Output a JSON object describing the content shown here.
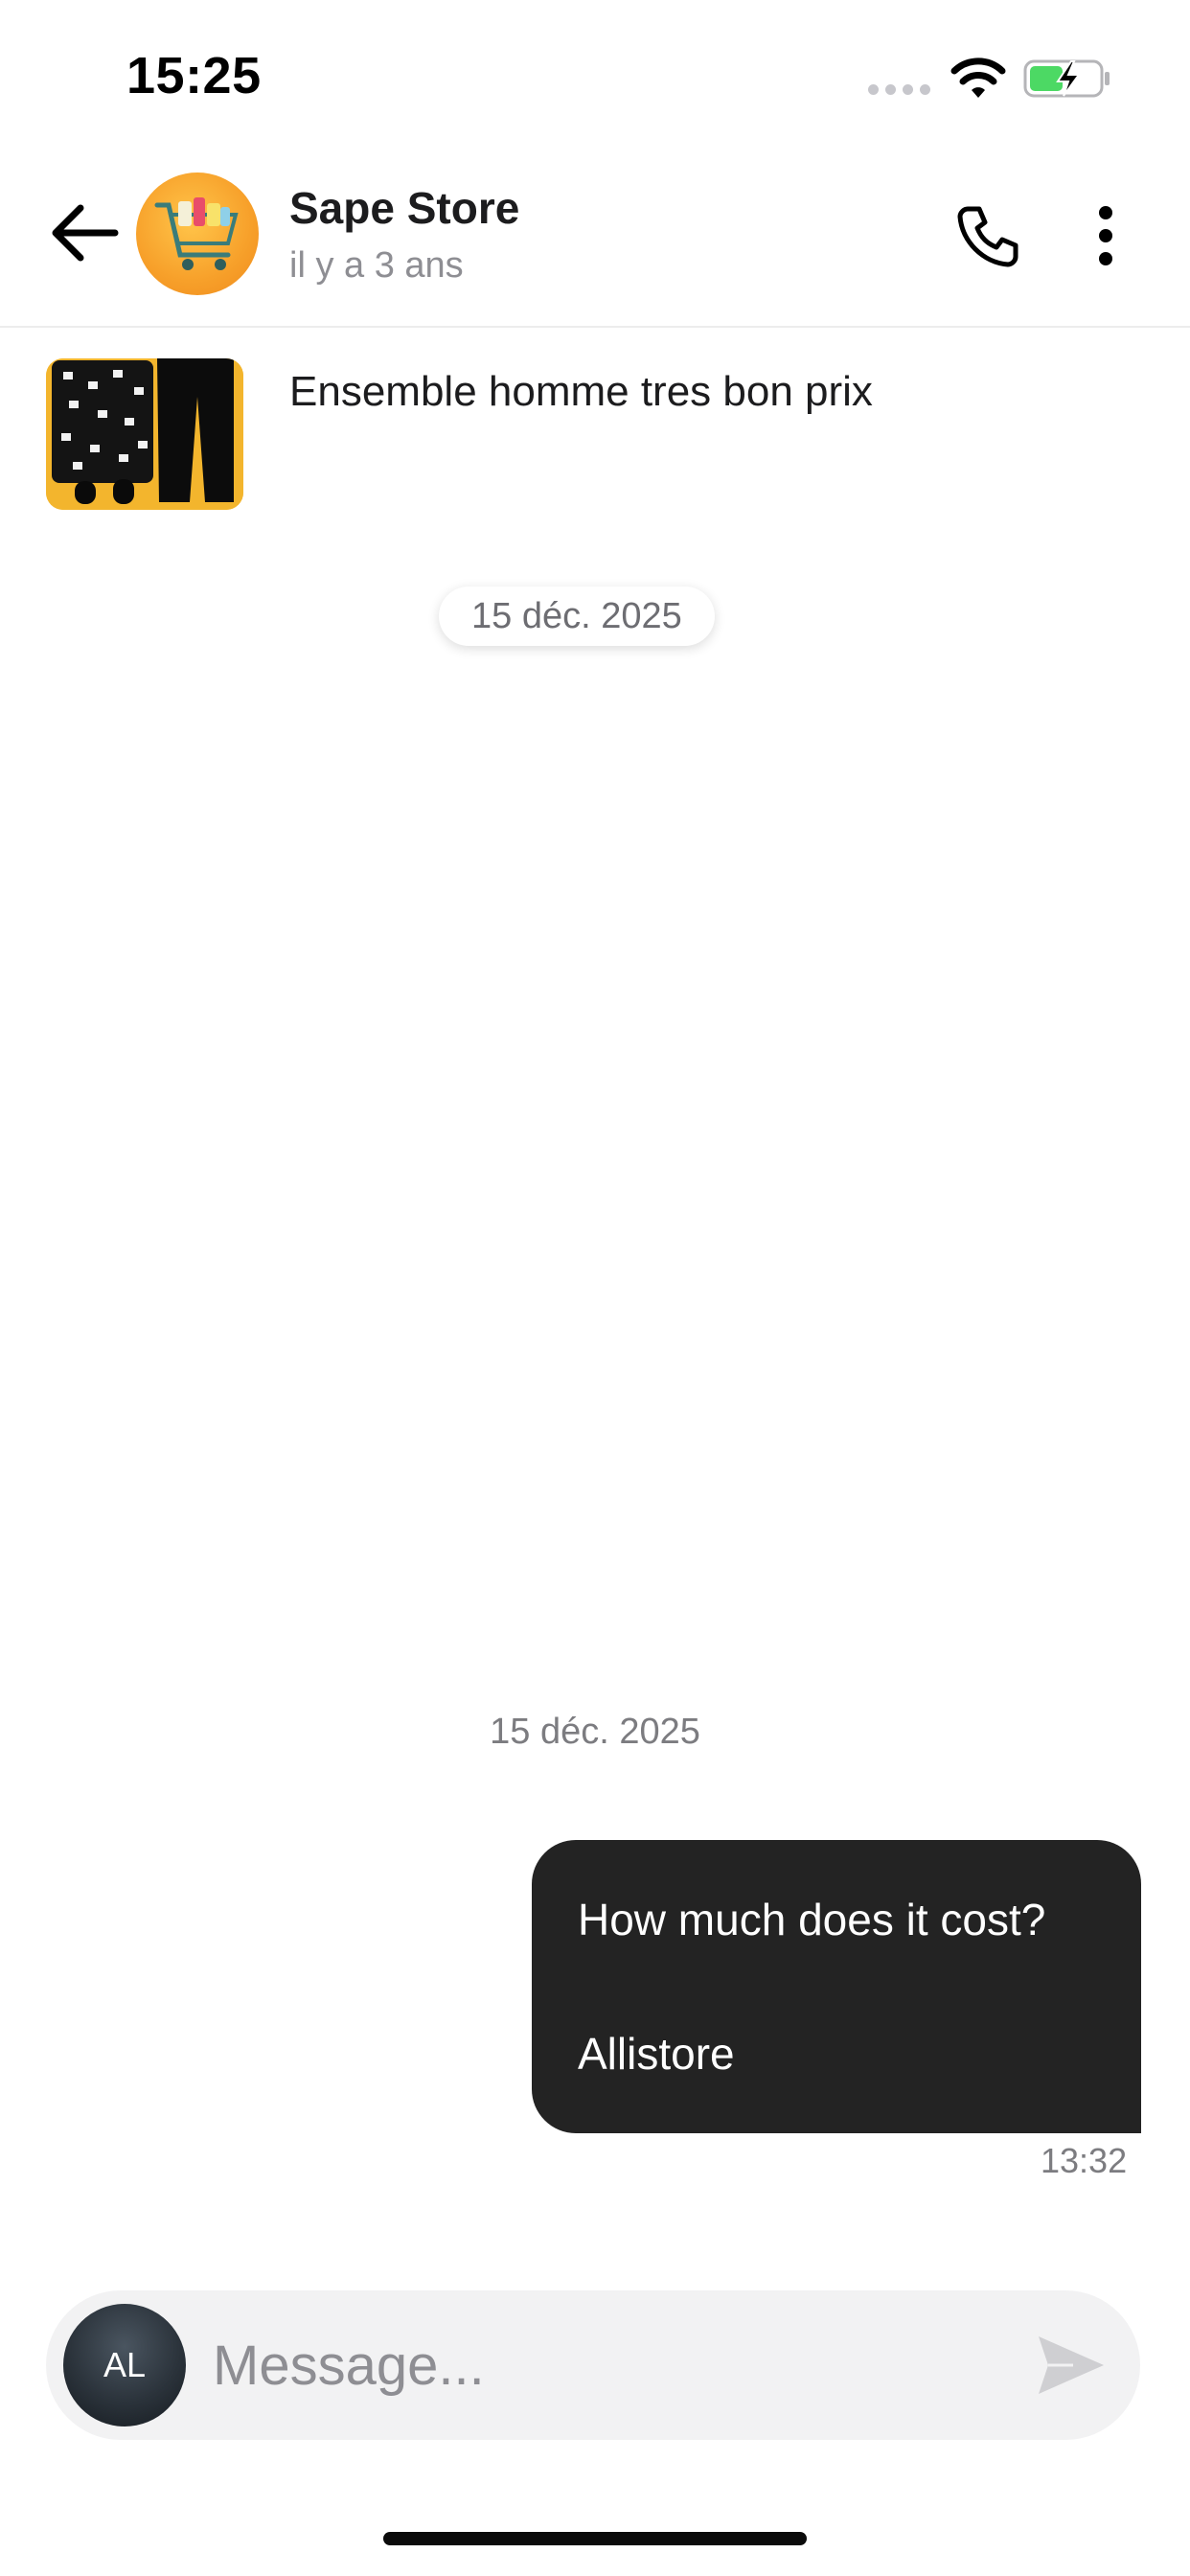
{
  "status_bar": {
    "time": "15:25"
  },
  "header": {
    "title": "Sape Store",
    "subtitle": "il y a 3 ans"
  },
  "product": {
    "title": "Ensemble homme tres bon prix"
  },
  "conversation": {
    "date_pill": "15 déc. 2025",
    "date_label": "15 déc. 2025",
    "messages": [
      {
        "lines": [
          "How much does it cost?",
          "Allistore"
        ],
        "time": "13:32"
      }
    ]
  },
  "composer": {
    "avatar_initials": "AL",
    "placeholder": "Message..."
  },
  "colors": {
    "bubble_bg": "#232323",
    "accent_orange": "#f7a02a",
    "battery_green": "#4cd964"
  },
  "icons": [
    "back-arrow-icon",
    "phone-icon",
    "more-vertical-icon",
    "send-icon",
    "wifi-icon",
    "battery-icon",
    "signal-icon"
  ]
}
